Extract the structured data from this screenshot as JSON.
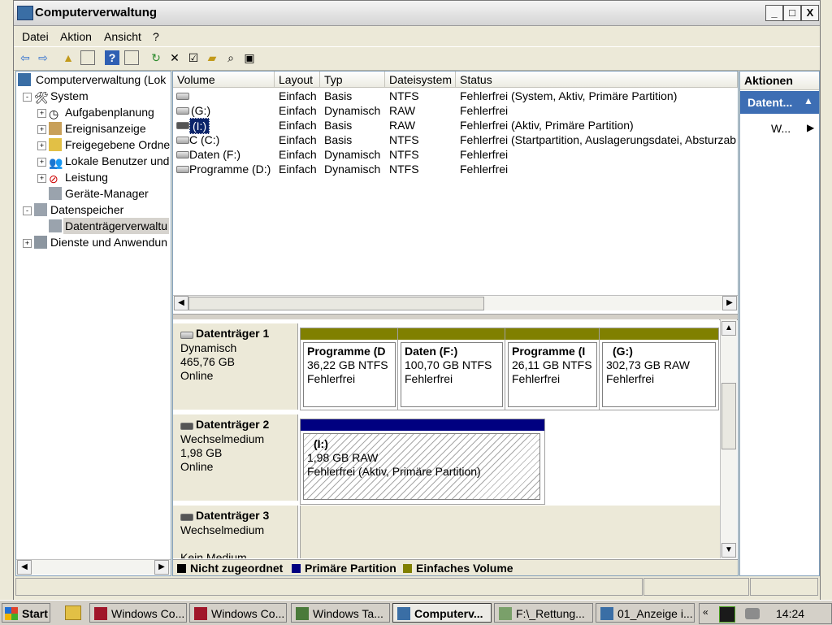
{
  "window": {
    "title": "Computerverwaltung"
  },
  "window_controls": {
    "minimize": "_",
    "maximize": "□",
    "close": "X"
  },
  "menu": [
    "Datei",
    "Aktion",
    "Ansicht",
    "?"
  ],
  "tree": {
    "items": [
      {
        "label": "Computerverwaltung (Lok",
        "level": 0
      },
      {
        "label": "System",
        "level": 1,
        "expander": "-"
      },
      {
        "label": "Aufgabenplanung",
        "level": 2,
        "expander": "+"
      },
      {
        "label": "Ereignisanzeige",
        "level": 2,
        "expander": "+"
      },
      {
        "label": "Freigegebene Ordne",
        "level": 2,
        "expander": "+"
      },
      {
        "label": "Lokale Benutzer und",
        "level": 2,
        "expander": "+"
      },
      {
        "label": "Leistung",
        "level": 2,
        "expander": "+"
      },
      {
        "label": "Geräte-Manager",
        "level": 2
      },
      {
        "label": "Datenspeicher",
        "level": 1,
        "expander": "-"
      },
      {
        "label": "Datenträgerverwaltu",
        "level": 2,
        "selected": true
      },
      {
        "label": "Dienste und Anwendun",
        "level": 1,
        "expander": "+"
      }
    ]
  },
  "volume_table": {
    "columns": [
      "Volume",
      "Layout",
      "Typ",
      "Dateisystem",
      "Status"
    ],
    "rows": [
      [
        "",
        "Einfach",
        "Basis",
        "NTFS",
        "Fehlerfrei (System, Aktiv, Primäre Partition)"
      ],
      [
        "(G:)",
        "Einfach",
        "Dynamisch",
        "RAW",
        "Fehlerfrei"
      ],
      [
        "(I:)",
        "Einfach",
        "Basis",
        "RAW",
        "Fehlerfrei (Aktiv, Primäre Partition)"
      ],
      [
        "C (C:)",
        "Einfach",
        "Basis",
        "NTFS",
        "Fehlerfrei (Startpartition, Auslagerungsdatei, Absturzabb"
      ],
      [
        "Daten (F:)",
        "Einfach",
        "Dynamisch",
        "NTFS",
        "Fehlerfrei"
      ],
      [
        "Programme (D:)",
        "Einfach",
        "Dynamisch",
        "NTFS",
        "Fehlerfrei"
      ]
    ]
  },
  "disks": [
    {
      "name": "Datenträger 1",
      "type": "Dynamisch",
      "size": "465,76 GB",
      "state": "Online",
      "partitions": [
        {
          "name": "Programme (D",
          "size": "36,22 GB NTFS",
          "status": "Fehlerfrei"
        },
        {
          "name": "Daten (F:)",
          "size": "100,70 GB NTFS",
          "status": "Fehlerfrei"
        },
        {
          "name": "Programme (I",
          "size": "26,11 GB NTFS",
          "status": "Fehlerfrei"
        },
        {
          "name": "(G:)",
          "size": "302,73 GB RAW",
          "status": "Fehlerfrei"
        }
      ]
    },
    {
      "name": "Datenträger 2",
      "type": "Wechselmedium",
      "size": "1,98 GB",
      "state": "Online",
      "partitions": [
        {
          "name": "(I:)",
          "size": "1,98 GB RAW",
          "status": "Fehlerfrei (Aktiv, Primäre Partition)"
        }
      ]
    },
    {
      "name": "Datenträger 3",
      "type": "Wechselmedium",
      "media": "Kein Medium"
    }
  ],
  "legend": [
    {
      "label": "Nicht zugeordnet",
      "color": "#000000"
    },
    {
      "label": "Primäre Partition",
      "color": "#000080"
    },
    {
      "label": "Einfaches Volume",
      "color": "#808000"
    }
  ],
  "actions": {
    "header": "Aktionen",
    "section": "Datent...",
    "item": "W..."
  },
  "taskbar": {
    "start": "Start",
    "tasks": [
      "Windows Co...",
      "Windows Co...",
      "Windows Ta...",
      "Computerv...",
      "F:\\_Rettung...",
      "01_Anzeige i..."
    ],
    "clock": "14:24"
  }
}
